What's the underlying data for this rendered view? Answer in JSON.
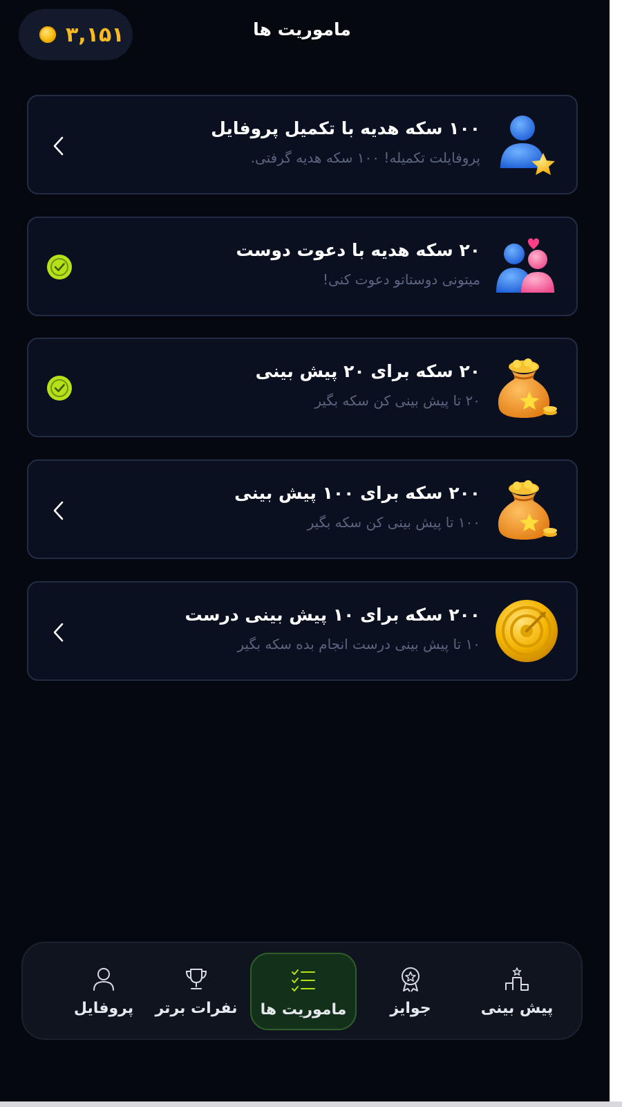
{
  "header": {
    "title": "ماموریت ها",
    "coins": "۳,۱۵۱",
    "coin_icon": "coin-icon"
  },
  "missions": [
    {
      "title": "۱۰۰ سکه هدیه با تکمیل پروفایل",
      "subtitle": "پروفایلت تکمیله! ۱۰۰ سکه هدیه گرفتی.",
      "icon": "user-star-icon",
      "status": "open"
    },
    {
      "title": "۲۰ سکه هدیه با دعوت دوست",
      "subtitle": "میتونی دوستاتو دعوت کنی!",
      "icon": "friends-heart-icon",
      "status": "done"
    },
    {
      "title": "۲۰ سکه برای ۲۰ پیش بینی",
      "subtitle": "۲۰ تا پیش بینی کن سکه بگیر",
      "icon": "coin-bag-icon",
      "status": "done"
    },
    {
      "title": "۲۰۰ سکه برای ۱۰۰ پیش بینی",
      "subtitle": "۱۰۰ تا پیش بینی کن سکه بگیر",
      "icon": "coin-bag-icon",
      "status": "open"
    },
    {
      "title": "۲۰۰ سکه برای ۱۰ پیش بینی درست",
      "subtitle": "۱۰ تا پیش بینی درست انجام بده سکه بگیر",
      "icon": "target-coin-icon",
      "status": "open"
    }
  ],
  "nav": {
    "items": [
      {
        "label": "پیش بینی",
        "icon": "podium-icon"
      },
      {
        "label": "جوایز",
        "icon": "award-badge-icon"
      },
      {
        "label": "ماموریت ها",
        "icon": "checklist-icon",
        "active": true
      },
      {
        "label": "نفرات برتر",
        "icon": "trophy-icon"
      },
      {
        "label": "پروفایل",
        "icon": "user-icon"
      }
    ]
  },
  "colors": {
    "background": "#06080f",
    "card": "#0b1020",
    "card_border": "#222c45",
    "coin_text": "#f7b924",
    "subtitle": "#5b6580",
    "check": "#b6e01a",
    "nav_active_bg": "#13301a"
  }
}
